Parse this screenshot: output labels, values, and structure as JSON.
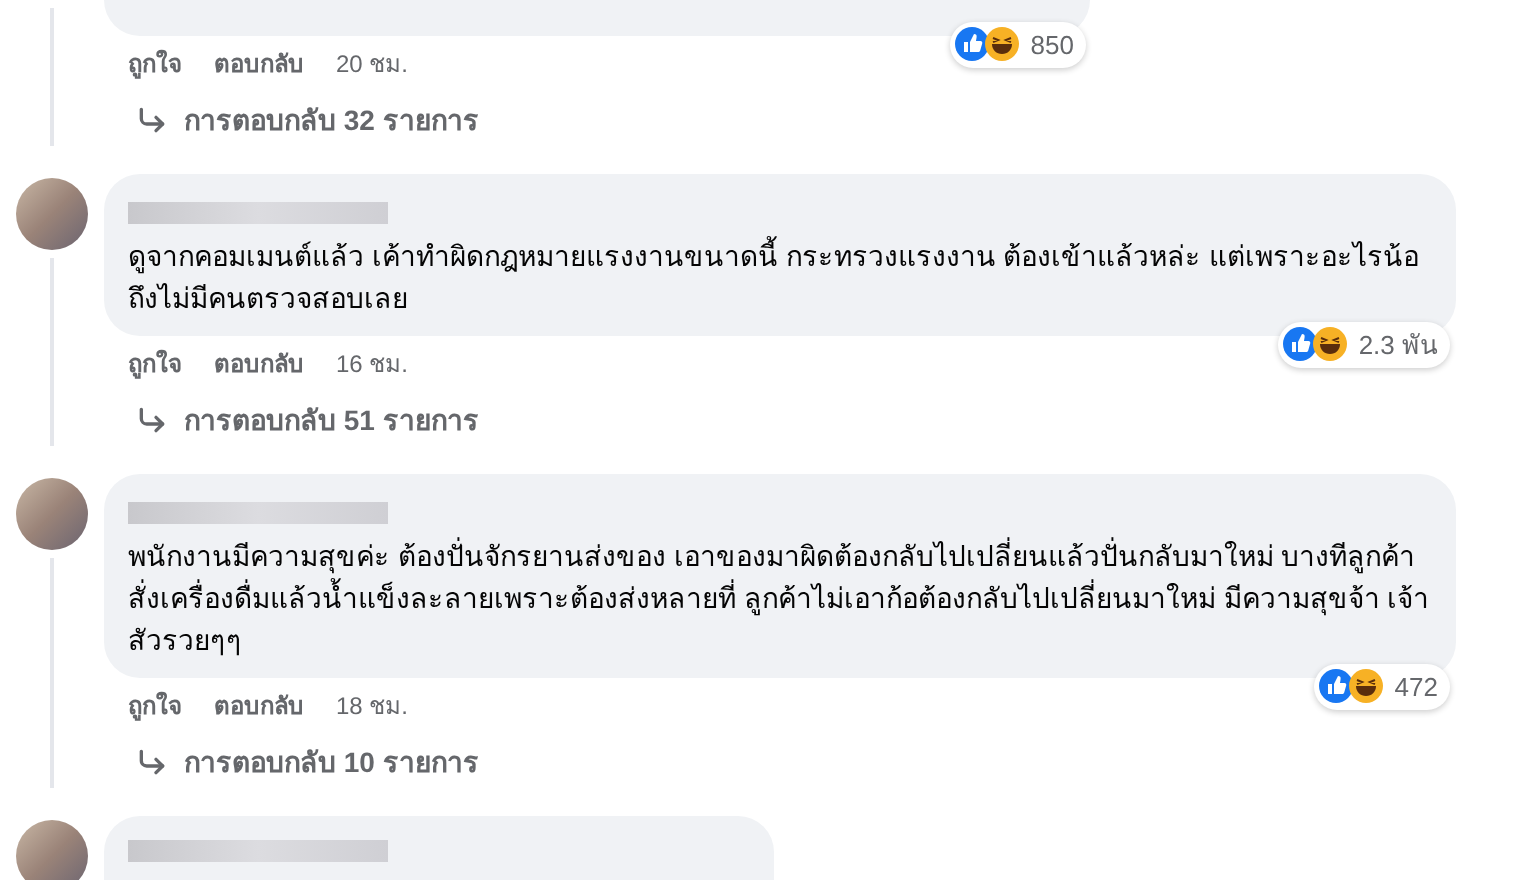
{
  "comments": [
    {
      "kind": "cut_top",
      "reactions": "850",
      "like": "ถูกใจ",
      "reply": "ตอบกลับ",
      "time": "20 ชม.",
      "replies": "การตอบกลับ 32 รายการ"
    },
    {
      "kind": "full",
      "text": "ดูจากคอมเมนต์แล้ว เค้าทำผิดกฎหมายแรงงานขนาดนี้ กระทรวงแรงงาน ต้องเข้าแล้วหล่ะ แต่เพราะอะไรน้อ ถึงไม่มีคนตรวจสอบเลย",
      "reactions": "2.3 พัน",
      "like": "ถูกใจ",
      "reply": "ตอบกลับ",
      "time": "16 ชม.",
      "replies": "การตอบกลับ 51 รายการ"
    },
    {
      "kind": "full",
      "text": "พนักงานมีความสุขค่ะ ต้องปั่นจักรยานส่งของ เอาของมาผิดต้องกลับไปเปลี่ยนแล้วปั่นกลับมาใหม่ บางทีลูกค้าสั่งเครื่องดื่มแล้วน้ำแข็งละลายเพราะต้องส่งหลายที่ ลูกค้าไม่เอาก้อต้องกลับไปเปลี่ยนมาใหม่ มีความสุขจ้า เจ้าสัวรวยๆๆ",
      "reactions": "472",
      "like": "ถูกใจ",
      "reply": "ตอบกลับ",
      "time": "18 ชม.",
      "replies": "การตอบกลับ 10 รายการ"
    },
    {
      "kind": "cut_bottom"
    }
  ]
}
